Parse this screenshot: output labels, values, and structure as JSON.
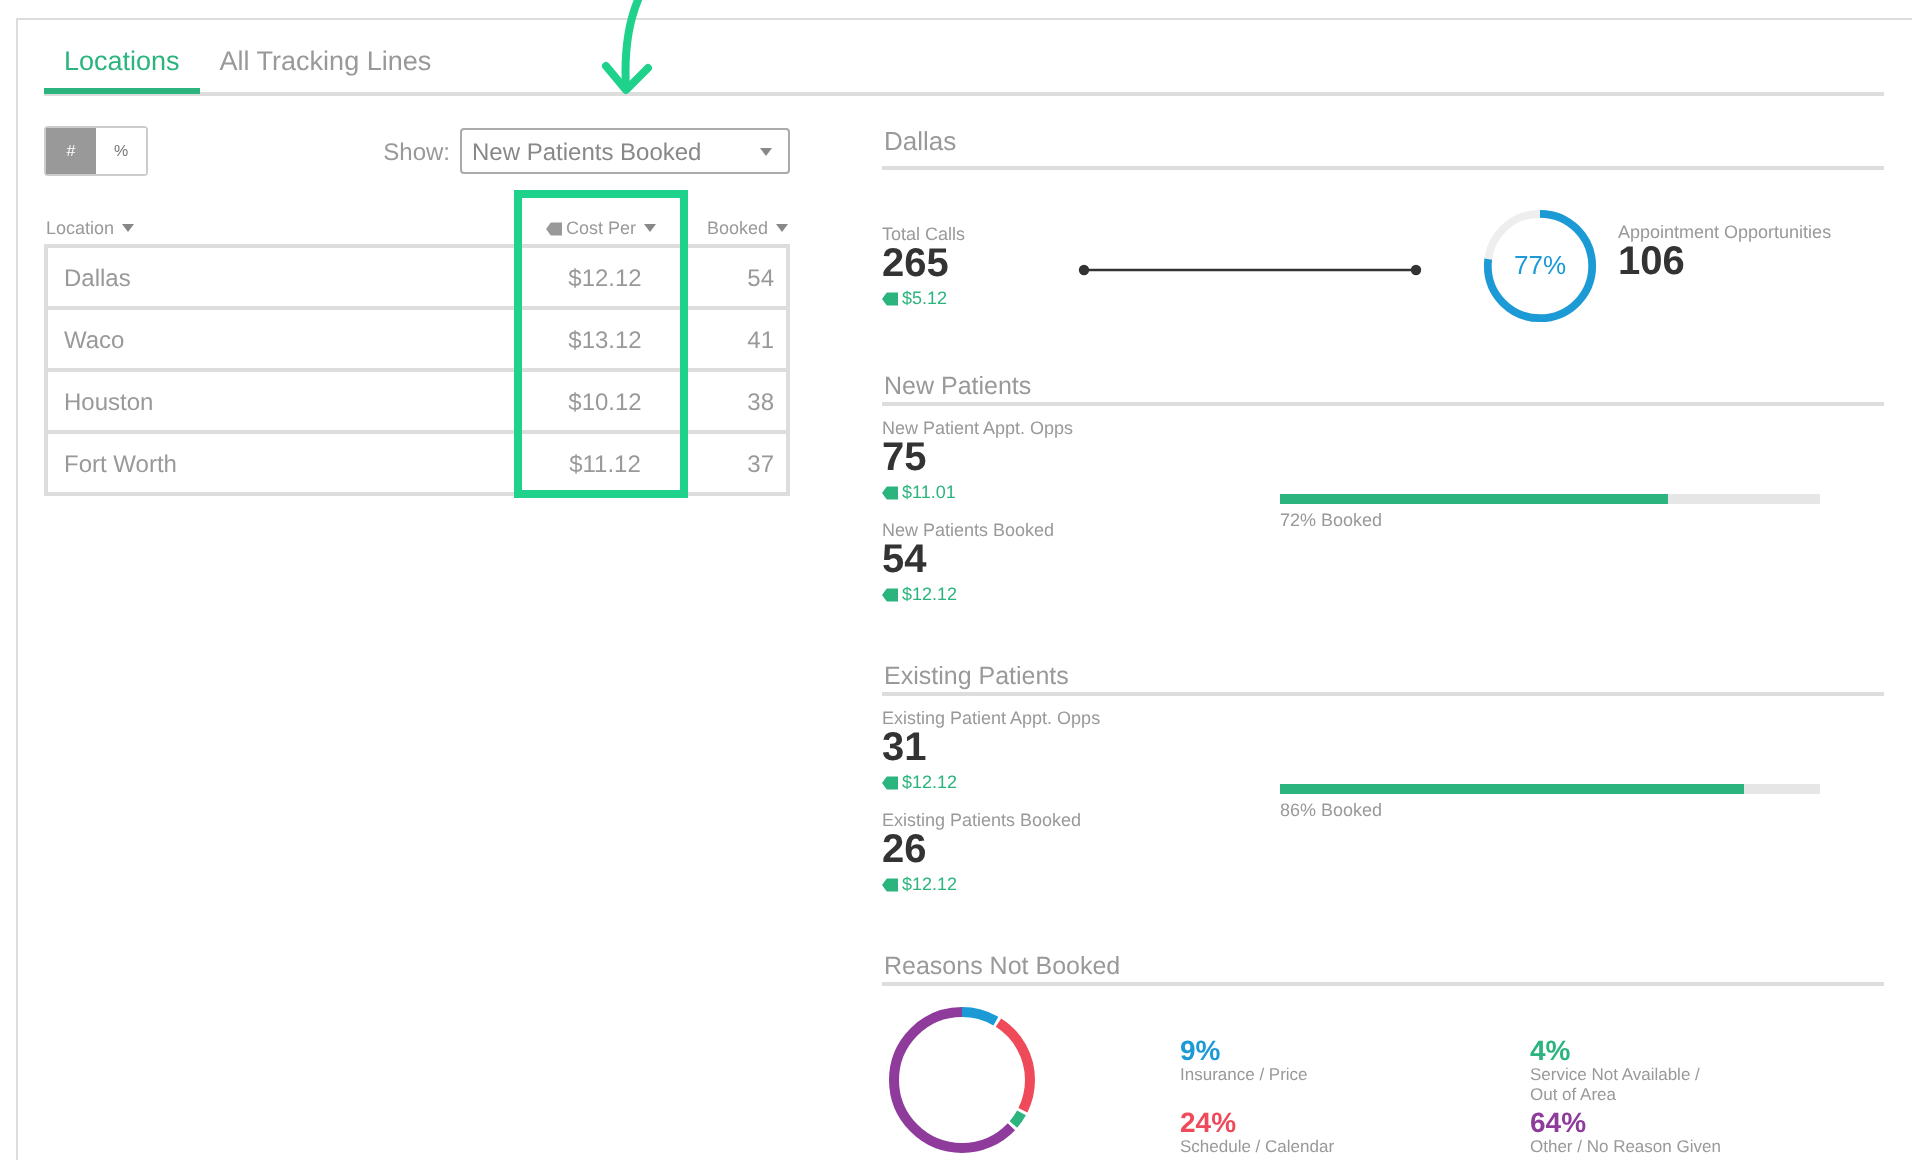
{
  "tabs": [
    {
      "label": "Locations",
      "selected": true
    },
    {
      "label": "All Tracking Lines",
      "selected": false
    }
  ],
  "toggle": [
    {
      "label": "#",
      "selected": true
    },
    {
      "label": "%",
      "selected": false
    }
  ],
  "show": {
    "label": "Show:",
    "value": "New Patients Booked"
  },
  "table": {
    "columns": [
      {
        "label": "Location",
        "tag": false,
        "highlighted": false
      },
      {
        "label": "Cost Per",
        "tag": true,
        "highlighted": true
      },
      {
        "label": "Booked",
        "tag": false,
        "highlighted": false
      }
    ],
    "rows": [
      [
        "Dallas",
        "$12.12",
        "54"
      ],
      [
        "Waco",
        "$13.12",
        "41"
      ],
      [
        "Houston",
        "$10.12",
        "38"
      ],
      [
        "Fort Worth",
        "$11.12",
        "37"
      ]
    ]
  },
  "detail": {
    "title": "Dallas",
    "total": {
      "label": "Total Calls",
      "value": "265",
      "cost": "$5.12"
    },
    "opportunities": {
      "label": "Appointment Opportunities",
      "value": "106",
      "gauge_text": "77%",
      "level": 0.77
    },
    "sections": [
      {
        "title": "New Patients",
        "stats": [
          {
            "label": "New Patient Appt. Opps",
            "value": "75",
            "cost": "$11.01"
          },
          {
            "label": "New Patients Booked",
            "value": "54",
            "cost": "$12.12"
          }
        ],
        "bar": {
          "level": 0.72,
          "text": "72% Booked"
        }
      },
      {
        "title": "Existing Patients",
        "stats": [
          {
            "label": "Existing Patient Appt. Opps",
            "value": "31",
            "cost": "$12.12"
          },
          {
            "label": "Existing Patients Booked",
            "value": "26",
            "cost": "$12.12"
          }
        ],
        "bar": {
          "level": 0.86,
          "text": "86% Booked"
        }
      }
    ],
    "reasons": {
      "title": "Reasons Not Booked",
      "items": [
        {
          "value": "9%",
          "label": "Insurance / Price",
          "color": "#1b9ad6"
        },
        {
          "value": "24%",
          "label": "Schedule / Calendar",
          "color": "#ef4a5a"
        },
        {
          "value": "4%",
          "label": "Service Not Available / Out of Area",
          "color": "#2bb47d"
        },
        {
          "value": "64%",
          "label": "Other / No Reason Given",
          "color": "#8e3b9c"
        }
      ]
    }
  }
}
